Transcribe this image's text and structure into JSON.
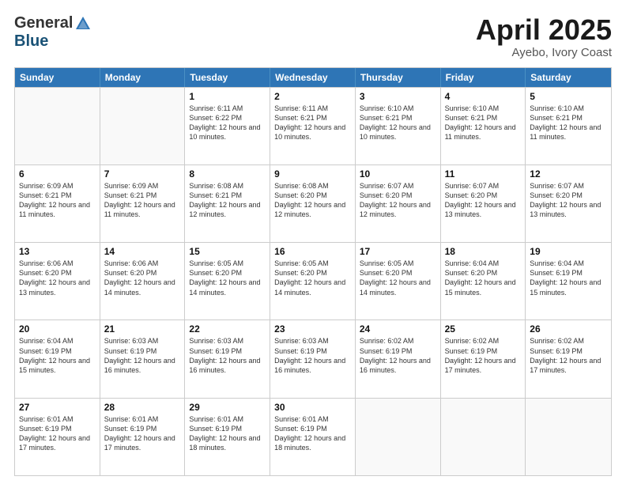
{
  "header": {
    "logo_general": "General",
    "logo_blue": "Blue",
    "title": "April 2025",
    "location": "Ayebo, Ivory Coast"
  },
  "weekdays": [
    "Sunday",
    "Monday",
    "Tuesday",
    "Wednesday",
    "Thursday",
    "Friday",
    "Saturday"
  ],
  "weeks": [
    [
      {
        "day": "",
        "info": ""
      },
      {
        "day": "",
        "info": ""
      },
      {
        "day": "1",
        "info": "Sunrise: 6:11 AM\nSunset: 6:22 PM\nDaylight: 12 hours and 10 minutes."
      },
      {
        "day": "2",
        "info": "Sunrise: 6:11 AM\nSunset: 6:21 PM\nDaylight: 12 hours and 10 minutes."
      },
      {
        "day": "3",
        "info": "Sunrise: 6:10 AM\nSunset: 6:21 PM\nDaylight: 12 hours and 10 minutes."
      },
      {
        "day": "4",
        "info": "Sunrise: 6:10 AM\nSunset: 6:21 PM\nDaylight: 12 hours and 11 minutes."
      },
      {
        "day": "5",
        "info": "Sunrise: 6:10 AM\nSunset: 6:21 PM\nDaylight: 12 hours and 11 minutes."
      }
    ],
    [
      {
        "day": "6",
        "info": "Sunrise: 6:09 AM\nSunset: 6:21 PM\nDaylight: 12 hours and 11 minutes."
      },
      {
        "day": "7",
        "info": "Sunrise: 6:09 AM\nSunset: 6:21 PM\nDaylight: 12 hours and 11 minutes."
      },
      {
        "day": "8",
        "info": "Sunrise: 6:08 AM\nSunset: 6:21 PM\nDaylight: 12 hours and 12 minutes."
      },
      {
        "day": "9",
        "info": "Sunrise: 6:08 AM\nSunset: 6:20 PM\nDaylight: 12 hours and 12 minutes."
      },
      {
        "day": "10",
        "info": "Sunrise: 6:07 AM\nSunset: 6:20 PM\nDaylight: 12 hours and 12 minutes."
      },
      {
        "day": "11",
        "info": "Sunrise: 6:07 AM\nSunset: 6:20 PM\nDaylight: 12 hours and 13 minutes."
      },
      {
        "day": "12",
        "info": "Sunrise: 6:07 AM\nSunset: 6:20 PM\nDaylight: 12 hours and 13 minutes."
      }
    ],
    [
      {
        "day": "13",
        "info": "Sunrise: 6:06 AM\nSunset: 6:20 PM\nDaylight: 12 hours and 13 minutes."
      },
      {
        "day": "14",
        "info": "Sunrise: 6:06 AM\nSunset: 6:20 PM\nDaylight: 12 hours and 14 minutes."
      },
      {
        "day": "15",
        "info": "Sunrise: 6:05 AM\nSunset: 6:20 PM\nDaylight: 12 hours and 14 minutes."
      },
      {
        "day": "16",
        "info": "Sunrise: 6:05 AM\nSunset: 6:20 PM\nDaylight: 12 hours and 14 minutes."
      },
      {
        "day": "17",
        "info": "Sunrise: 6:05 AM\nSunset: 6:20 PM\nDaylight: 12 hours and 14 minutes."
      },
      {
        "day": "18",
        "info": "Sunrise: 6:04 AM\nSunset: 6:20 PM\nDaylight: 12 hours and 15 minutes."
      },
      {
        "day": "19",
        "info": "Sunrise: 6:04 AM\nSunset: 6:19 PM\nDaylight: 12 hours and 15 minutes."
      }
    ],
    [
      {
        "day": "20",
        "info": "Sunrise: 6:04 AM\nSunset: 6:19 PM\nDaylight: 12 hours and 15 minutes."
      },
      {
        "day": "21",
        "info": "Sunrise: 6:03 AM\nSunset: 6:19 PM\nDaylight: 12 hours and 16 minutes."
      },
      {
        "day": "22",
        "info": "Sunrise: 6:03 AM\nSunset: 6:19 PM\nDaylight: 12 hours and 16 minutes."
      },
      {
        "day": "23",
        "info": "Sunrise: 6:03 AM\nSunset: 6:19 PM\nDaylight: 12 hours and 16 minutes."
      },
      {
        "day": "24",
        "info": "Sunrise: 6:02 AM\nSunset: 6:19 PM\nDaylight: 12 hours and 16 minutes."
      },
      {
        "day": "25",
        "info": "Sunrise: 6:02 AM\nSunset: 6:19 PM\nDaylight: 12 hours and 17 minutes."
      },
      {
        "day": "26",
        "info": "Sunrise: 6:02 AM\nSunset: 6:19 PM\nDaylight: 12 hours and 17 minutes."
      }
    ],
    [
      {
        "day": "27",
        "info": "Sunrise: 6:01 AM\nSunset: 6:19 PM\nDaylight: 12 hours and 17 minutes."
      },
      {
        "day": "28",
        "info": "Sunrise: 6:01 AM\nSunset: 6:19 PM\nDaylight: 12 hours and 17 minutes."
      },
      {
        "day": "29",
        "info": "Sunrise: 6:01 AM\nSunset: 6:19 PM\nDaylight: 12 hours and 18 minutes."
      },
      {
        "day": "30",
        "info": "Sunrise: 6:01 AM\nSunset: 6:19 PM\nDaylight: 12 hours and 18 minutes."
      },
      {
        "day": "",
        "info": ""
      },
      {
        "day": "",
        "info": ""
      },
      {
        "day": "",
        "info": ""
      }
    ]
  ]
}
